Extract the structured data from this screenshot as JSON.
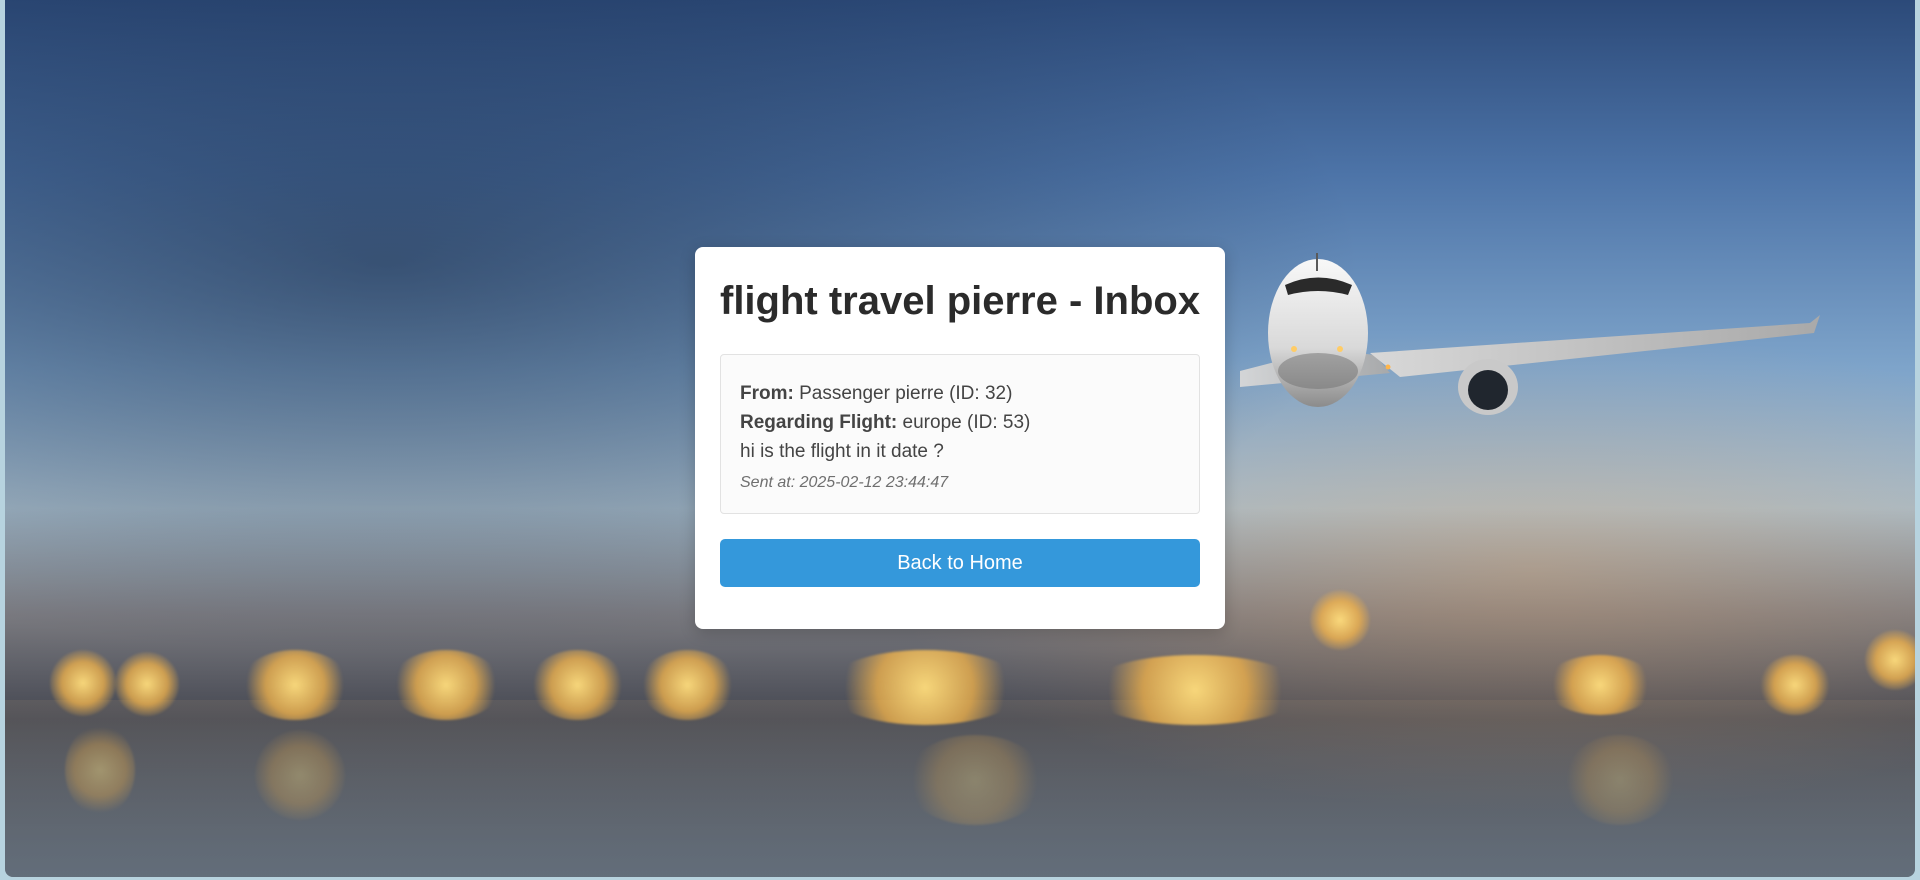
{
  "page": {
    "title": "flight travel pierre - Inbox"
  },
  "message": {
    "from_label": "From:",
    "from_value": "Passenger pierre (ID: 32)",
    "regarding_label": "Regarding Flight:",
    "regarding_value": "europe (ID: 53)",
    "body": "hi is the flight in it date ?",
    "sent_at": "Sent at: 2025-02-12 23:44:47"
  },
  "actions": {
    "back_label": "Back to Home"
  },
  "colors": {
    "button_bg": "#3498db",
    "card_bg": "#ffffff"
  },
  "background": {
    "image": "airplane-over-runway-bokeh"
  }
}
